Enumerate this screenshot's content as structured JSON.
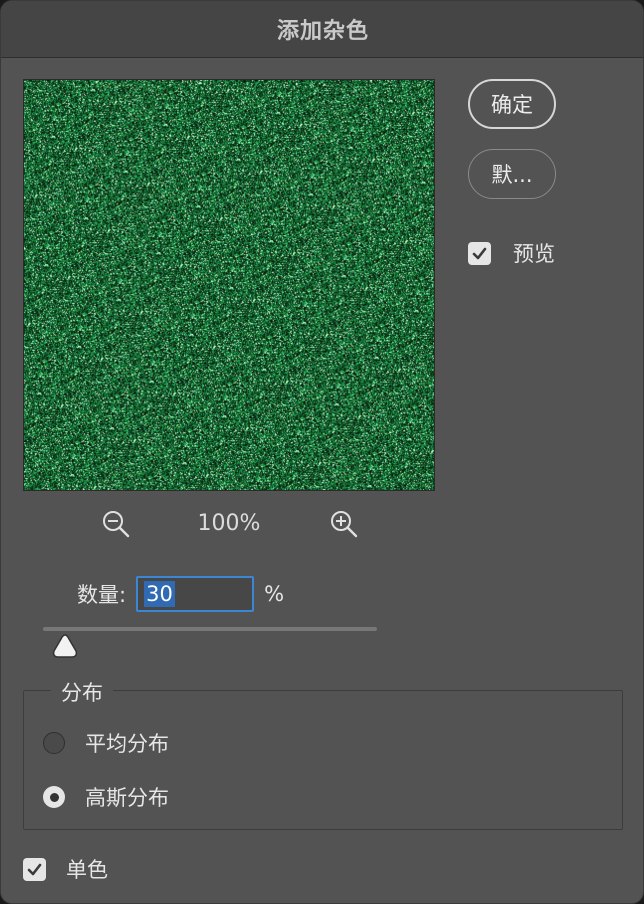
{
  "dialog": {
    "title": "添加杂色"
  },
  "buttons": {
    "ok_label": "确定",
    "default_label": "默..."
  },
  "preview": {
    "label": "预览",
    "checked": true,
    "zoom_level": "100%",
    "noise_color": "#1e8f52"
  },
  "amount": {
    "label": "数量:",
    "value": "30",
    "unit": "%"
  },
  "distribution": {
    "title": "分布",
    "options": [
      {
        "label": "平均分布",
        "selected": false
      },
      {
        "label": "高斯分布",
        "selected": true
      }
    ]
  },
  "monochrome": {
    "label": "单色",
    "checked": true
  },
  "icons": {
    "zoom_out": "zoom-out-icon",
    "zoom_in": "zoom-in-icon",
    "checkmark": "checkmark-icon"
  }
}
